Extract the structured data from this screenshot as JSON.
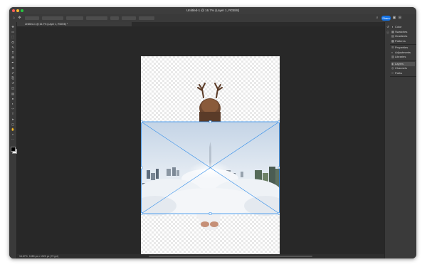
{
  "window": {
    "title": "Untitled-1 @ 16.7% (Layer 1, RGB/8)"
  },
  "options_bar": {
    "icons": [
      "home-icon",
      "move-tool-icon",
      "auto-select-icon",
      "align-icon",
      "3d-mode-icon"
    ],
    "share_label": "Share",
    "right_icons": [
      "search-icon",
      "workspace-icon"
    ]
  },
  "doc_tab": {
    "label": "Untitled-1 @ 16.7% (Layer 1, RGB/8) *"
  },
  "toolbar": {
    "tools": [
      "move-tool-icon",
      "artboard-icon",
      "marquee-tool-icon",
      "lasso-tool-icon",
      "quick-select-icon",
      "crop-tool-icon",
      "frame-tool-icon",
      "eyedropper-icon",
      "healing-brush-icon",
      "brush-tool-icon",
      "clone-stamp-icon",
      "history-brush-icon",
      "eraser-tool-icon",
      "gradient-tool-icon",
      "blur-tool-icon",
      "dodge-tool-icon",
      "pen-tool-icon",
      "type-tool-icon",
      "path-select-icon",
      "shape-tool-icon",
      "hand-tool-icon",
      "zoom-tool-icon",
      "more-tools-icon"
    ],
    "glyphs": [
      "✥",
      "▭",
      "⬚",
      "ⵔ",
      "✎",
      "⌗",
      "⊠",
      "✒",
      "✚",
      "✐",
      "⎘",
      "↺",
      "◫",
      "▤",
      "●",
      "◐",
      "✑",
      "T",
      "➤",
      "▢",
      "✋",
      "⌕",
      "⋯"
    ],
    "foreground_color": "#000000",
    "background_color": "#ffffff"
  },
  "panels": {
    "group1": [
      "Color",
      "Swatches",
      "Gradients",
      "Patterns"
    ],
    "group2": [
      "Properties",
      "Adjustments",
      "Libraries"
    ],
    "group3": [
      "Layers",
      "Channels",
      "Paths"
    ],
    "active": "Layers"
  },
  "status": {
    "zoom": "16.67%",
    "doc_info": "1080 px x 1920 px (72 ppi)"
  },
  "transform": {
    "handles_color": "#2d8ceb"
  }
}
